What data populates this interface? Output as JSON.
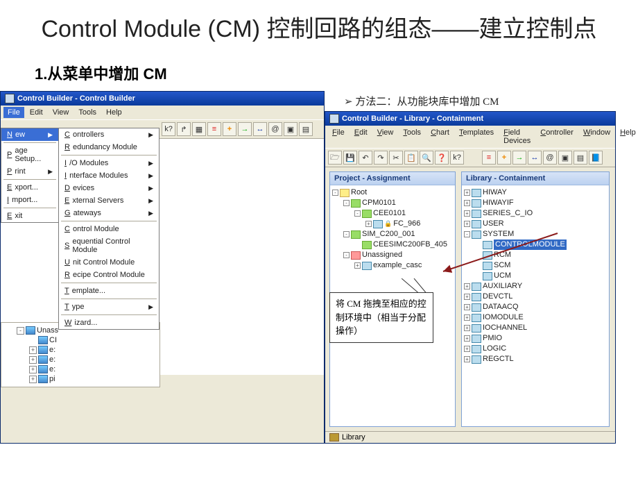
{
  "slide": {
    "title": "Control Module (CM)  控制回路的组态——建立控制点",
    "section1": "1.从菜单中增加  CM",
    "method2": "方法二：从功能块库中增加 CM"
  },
  "leftWindow": {
    "title": "Control Builder - Control Builder",
    "menubar": [
      "File",
      "Edit",
      "View",
      "Tools",
      "Help"
    ],
    "fileMenu": [
      {
        "label": "New",
        "kind": "hl",
        "arrow": true
      },
      {
        "kind": "sep"
      },
      {
        "label": "Page Setup..."
      },
      {
        "label": "Print",
        "arrow": true
      },
      {
        "kind": "sep"
      },
      {
        "label": "Export..."
      },
      {
        "label": "Import..."
      },
      {
        "kind": "sep"
      },
      {
        "label": "Exit"
      }
    ],
    "newSubMenu": [
      {
        "label": "Controllers",
        "arrow": true
      },
      {
        "label": "Redundancy Module"
      },
      {
        "kind": "sep"
      },
      {
        "label": "I/O Modules",
        "arrow": true
      },
      {
        "label": "Interface Modules",
        "arrow": true
      },
      {
        "label": "Devices",
        "arrow": true
      },
      {
        "label": "External Servers",
        "arrow": true
      },
      {
        "label": "Gateways",
        "arrow": true
      },
      {
        "kind": "sep"
      },
      {
        "label": "Control Module"
      },
      {
        "label": "Sequential Control Module"
      },
      {
        "label": "Unit Control Module"
      },
      {
        "label": "Recipe Control Module"
      },
      {
        "kind": "sep"
      },
      {
        "label": "Template..."
      },
      {
        "kind": "sep"
      },
      {
        "label": "Type",
        "arrow": true
      },
      {
        "kind": "sep"
      },
      {
        "label": "Wizard..."
      }
    ],
    "toolbarIcons": [
      "k?",
      "↱",
      "▦",
      "≡",
      "+",
      "→",
      "↔",
      "@",
      "▣",
      "▤"
    ],
    "projectTree": [
      {
        "ind": 1,
        "exp": "-",
        "label": "Unass"
      },
      {
        "ind": 2,
        "exp": "",
        "label": "CI"
      },
      {
        "ind": 2,
        "exp": "+",
        "label": "e:"
      },
      {
        "ind": 2,
        "exp": "+",
        "label": "e:"
      },
      {
        "ind": 2,
        "exp": "+",
        "label": "e:"
      },
      {
        "ind": 2,
        "exp": "+",
        "label": "pi"
      }
    ]
  },
  "rightWindow": {
    "title": "Control Builder - Library - Containment",
    "menubar": [
      "File",
      "Edit",
      "View",
      "Tools",
      "Chart",
      "Templates",
      "Field Devices",
      "Controller",
      "Window",
      "Help"
    ],
    "toolbarIcons": [
      "🗁",
      "💾",
      "↶",
      "↷",
      "✂",
      "📋",
      "🔍",
      "❓",
      "k?",
      "",
      "",
      "",
      "≡",
      "+",
      "→",
      "↔",
      "@",
      "▣",
      "▤",
      "📘"
    ],
    "projectPanel": {
      "header": "Project - Assignment",
      "tree": [
        {
          "ind": 0,
          "exp": "-",
          "icon": "yel",
          "label": "Root"
        },
        {
          "ind": 1,
          "exp": "-",
          "icon": "grn",
          "label": "CPM0101"
        },
        {
          "ind": 2,
          "exp": "-",
          "icon": "grn",
          "label": "CEE0101"
        },
        {
          "ind": 3,
          "exp": "+",
          "icon": "",
          "label": "FC_966",
          "lock": true
        },
        {
          "ind": 1,
          "exp": "-",
          "icon": "grn",
          "label": "SIM_C200_001"
        },
        {
          "ind": 2,
          "exp": "",
          "icon": "grn",
          "label": "CEESIMC200FB_405"
        },
        {
          "ind": 1,
          "exp": "-",
          "icon": "red",
          "label": "Unassigned"
        },
        {
          "ind": 2,
          "exp": "+",
          "icon": "",
          "label": "example_casc"
        }
      ]
    },
    "libraryPanel": {
      "header": "Library - Containment",
      "tree": [
        {
          "ind": 0,
          "exp": "+",
          "icon": "",
          "label": "HIWAY"
        },
        {
          "ind": 0,
          "exp": "+",
          "icon": "",
          "label": "HIWAYIF"
        },
        {
          "ind": 0,
          "exp": "+",
          "icon": "",
          "label": "SERIES_C_IO"
        },
        {
          "ind": 0,
          "exp": "+",
          "icon": "",
          "label": "USER"
        },
        {
          "ind": 0,
          "exp": "-",
          "icon": "",
          "label": "SYSTEM"
        },
        {
          "ind": 1,
          "exp": "",
          "icon": "",
          "label": "CONTROLMODULE",
          "sel": true
        },
        {
          "ind": 1,
          "exp": "",
          "icon": "",
          "label": "RCM"
        },
        {
          "ind": 1,
          "exp": "",
          "icon": "",
          "label": "SCM"
        },
        {
          "ind": 1,
          "exp": "",
          "icon": "",
          "label": "UCM"
        },
        {
          "ind": 0,
          "exp": "+",
          "icon": "",
          "label": "AUXILIARY"
        },
        {
          "ind": 0,
          "exp": "+",
          "icon": "",
          "label": "DEVCTL"
        },
        {
          "ind": 0,
          "exp": "+",
          "icon": "",
          "label": "DATAACQ"
        },
        {
          "ind": 0,
          "exp": "+",
          "icon": "",
          "label": "IOMODULE"
        },
        {
          "ind": 0,
          "exp": "+",
          "icon": "",
          "label": "IOCHANNEL"
        },
        {
          "ind": 0,
          "exp": "+",
          "icon": "",
          "label": "PMIO"
        },
        {
          "ind": 0,
          "exp": "+",
          "icon": "",
          "label": "LOGIC"
        },
        {
          "ind": 0,
          "exp": "+",
          "icon": "",
          "label": "REGCTL"
        }
      ]
    },
    "statusbar": "Library",
    "callout": "将 CM 拖拽至相应的控制环境中（相当于分配操作）"
  }
}
